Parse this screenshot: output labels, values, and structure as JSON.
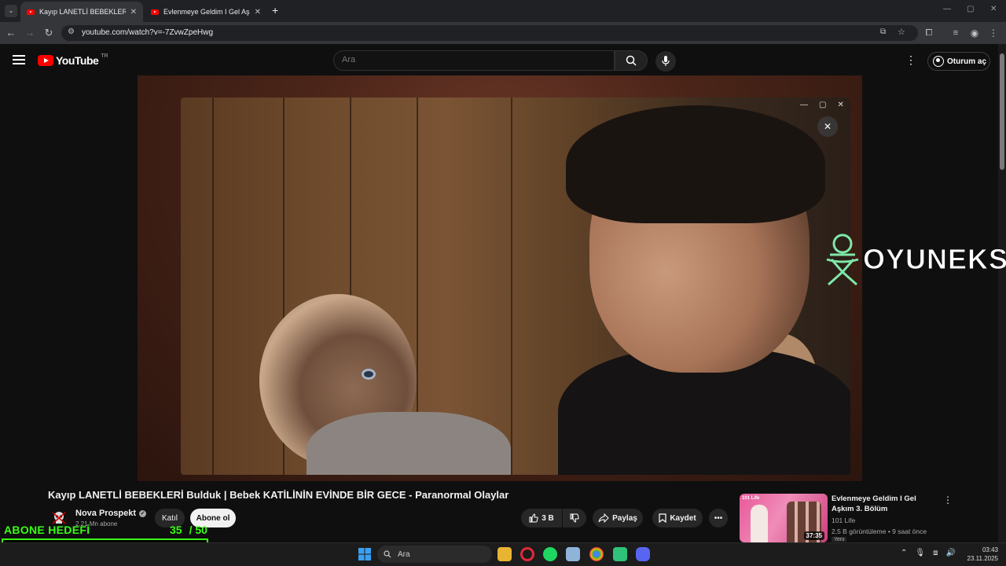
{
  "browser": {
    "tabs": [
      {
        "title": "Kayıp LANETLİ BEBEKLERİ Bulduk",
        "active": true
      },
      {
        "title": "Evlenmeye Geldim I Gel Aşkım",
        "active": false
      }
    ],
    "url": "youtube.com/watch?v=-7ZvwZpeHwg"
  },
  "youtube": {
    "logo_text": "YouTube",
    "region": "TR",
    "search_placeholder": "Ara",
    "signin_label": "Oturum aç"
  },
  "watermark": {
    "text": "OYUNEKS",
    "color": "#7ee8a8"
  },
  "video": {
    "title": "Kayıp LANETLİ BEBEKLERİ Bulduk | Bebek KATİLİNİN EVİNDE BİR GECE - Paranormal Olaylar",
    "channel": "Nova Prospekt",
    "subscribers": "2,21 Mn abone",
    "join_label": "Katıl",
    "subscribe_label": "Abone ol",
    "likes": "3 B",
    "share_label": "Paylaş",
    "save_label": "Kaydet"
  },
  "recommendation": {
    "title": "Evlenmeye Geldim I Gel Aşkım 3. Bölüm",
    "channel": "101 Life",
    "meta": "2,5 B görüntüleme • 9 saat önce",
    "duration": "37:35",
    "thumb_label": "101 Life",
    "new_badge": "Yeni"
  },
  "goal": {
    "label": "ABONE HEDEFİ",
    "current": "35",
    "target": "/ 50",
    "progress_fraction": 0.7,
    "color": "#39ff14"
  },
  "taskbar": {
    "search_label": "Ara",
    "time": "03:43",
    "date": "23.11.2025"
  }
}
